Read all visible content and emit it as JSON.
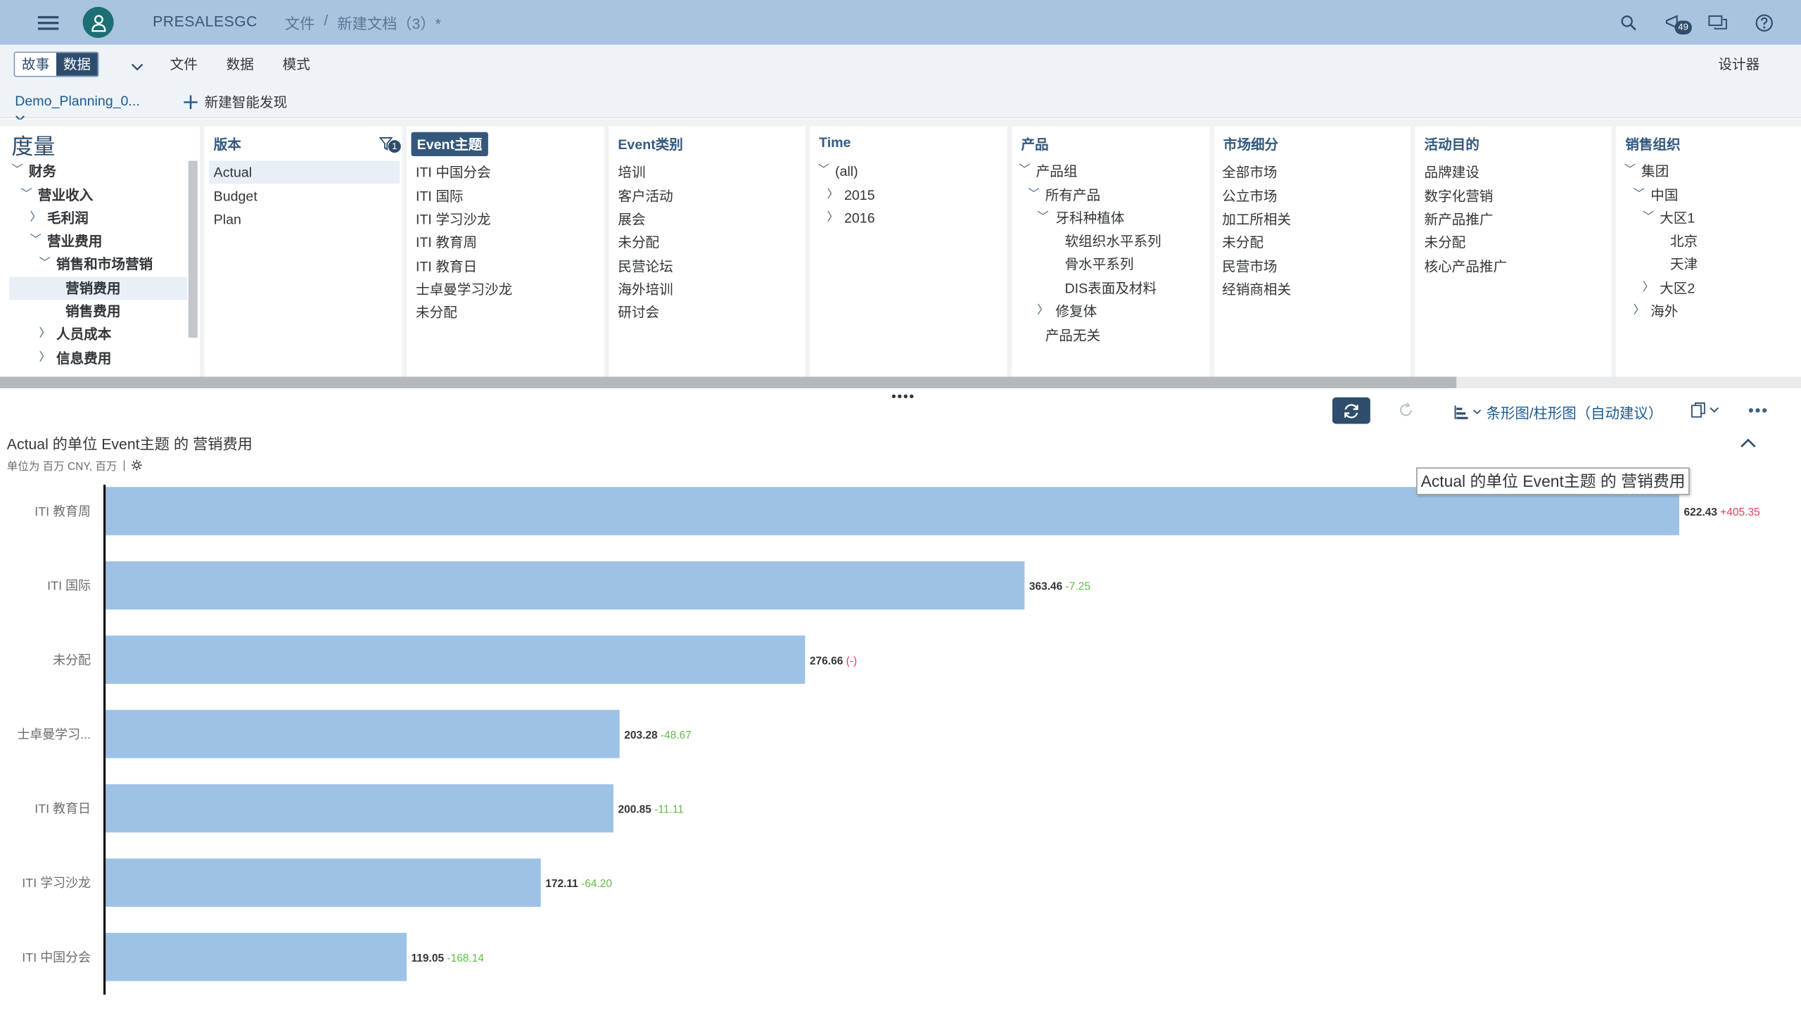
{
  "shell": {
    "tenant": "PRESALESGC",
    "breadcrumb": [
      "文件",
      "/",
      "新建文档（3）*"
    ],
    "notification_count": "49"
  },
  "toolbar": {
    "story_label": "故事",
    "data_label": "数据",
    "file_menu": "文件",
    "data_menu": "数据",
    "mode_menu": "模式",
    "designer_label": "设计器"
  },
  "tabs": {
    "model_tab": "Demo_Planning_0...",
    "new_discovery": "新建智能发现"
  },
  "panels": {
    "measures": {
      "title": "度量",
      "items": [
        "财务",
        "营业收入",
        "毛利润",
        "营业费用",
        "销售和市场营销",
        "营销费用",
        "销售费用",
        "人员成本",
        "信息费用"
      ]
    },
    "version": {
      "title": "版本",
      "filter_count": "1",
      "items": [
        "Actual",
        "Budget",
        "Plan"
      ]
    },
    "event_topic": {
      "title": "Event主题",
      "items": [
        "ITI 中国分会",
        "ITI 国际",
        "ITI 学习沙龙",
        "ITI 教育周",
        "ITI 教育日",
        "士卓曼学习沙龙",
        "未分配"
      ]
    },
    "event_type": {
      "title": "Event类别",
      "items": [
        "培训",
        "客户活动",
        "展会",
        "未分配",
        "民营论坛",
        "海外培训",
        "研讨会"
      ]
    },
    "time": {
      "title": "Time",
      "items": [
        "(all)",
        "2015",
        "2016"
      ]
    },
    "product": {
      "title": "产品",
      "items": [
        "产品组",
        "所有产品",
        "牙科种植体",
        "软组织水平系列",
        "骨水平系列",
        "DIS表面及材料",
        "修复体",
        "产品无关"
      ]
    },
    "market": {
      "title": "市场细分",
      "items": [
        "全部市场",
        "公立市场",
        "加工所相关",
        "未分配",
        "民营市场",
        "经销商相关"
      ]
    },
    "purpose": {
      "title": "活动目的",
      "items": [
        "品牌建设",
        "数字化营销",
        "新产品推广",
        "未分配",
        "核心产品推广"
      ]
    },
    "sales_org": {
      "title": "销售组织",
      "items": [
        "集团",
        "中国",
        "大区1",
        "北京",
        "天津",
        "大区2",
        "海外"
      ]
    }
  },
  "chart_controls": {
    "chart_type_label": "条形图/柱形图（自动建议）"
  },
  "chart_data": {
    "type": "bar",
    "orientation": "horizontal",
    "title": "Actual 的单位 Event主题 的 营销费用",
    "subtitle": "单位为 百万 CNY, 百万",
    "tooltip": "Actual 的单位 Event主题 的 营销费用",
    "categories": [
      "ITI 教育周",
      "ITI 国际",
      "未分配",
      "士卓曼学习...",
      "ITI 教育日",
      "ITI 学习沙龙",
      "ITI 中国分会"
    ],
    "values": [
      622.43,
      363.46,
      276.66,
      203.28,
      200.85,
      172.11,
      119.05
    ],
    "value_labels": [
      "622.43",
      "363.46",
      "276.66",
      "203.28",
      "200.85",
      "172.11",
      "119.05"
    ],
    "variance_labels": [
      "+405.35",
      "-7.25",
      "(-)",
      "-48.67",
      "-11.11",
      "-64.20",
      "-168.14"
    ],
    "variance_colors": [
      "#e0405a",
      "#5fbd45",
      "#e0405a",
      "#5fbd45",
      "#5fbd45",
      "#5fbd45",
      "#5fbd45"
    ],
    "bar_color": "#9dc2e6",
    "xlim": [
      0,
      622.43
    ]
  }
}
